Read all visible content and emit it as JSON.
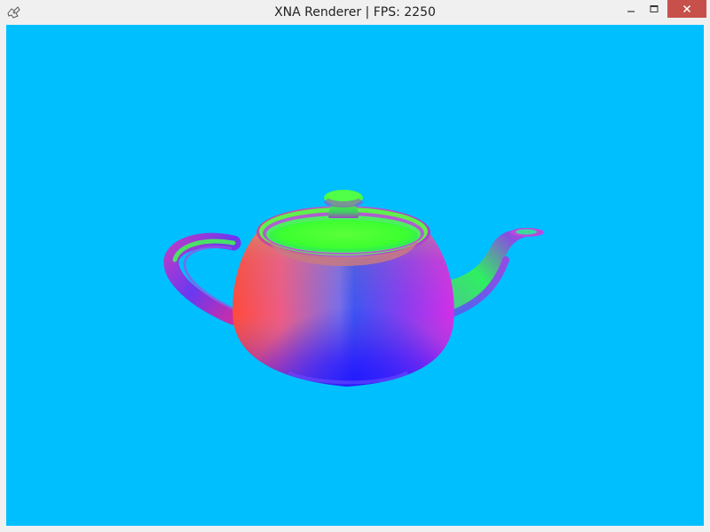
{
  "window": {
    "title": "XNA Renderer | FPS: 2250",
    "app_icon": "xna-app-icon",
    "controls": {
      "minimize": "minimize-icon",
      "maximize": "maximize-icon",
      "close": "close-icon"
    }
  },
  "viewport": {
    "background_color": "#00bfff",
    "object": "teapot",
    "shading": "normal-map"
  }
}
